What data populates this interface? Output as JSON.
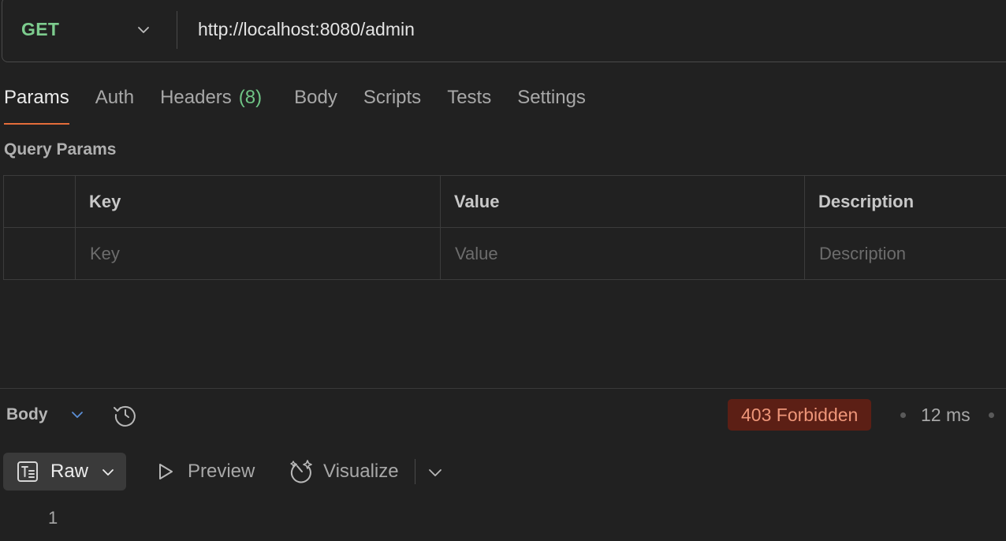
{
  "request": {
    "method": "GET",
    "url": "http://localhost:8080/admin"
  },
  "tabs": [
    {
      "label": "Params",
      "active": true
    },
    {
      "label": "Auth"
    },
    {
      "label": "Headers",
      "count": "(8)"
    },
    {
      "label": "Body"
    },
    {
      "label": "Scripts"
    },
    {
      "label": "Tests"
    },
    {
      "label": "Settings"
    }
  ],
  "query_params": {
    "title": "Query Params",
    "headers": {
      "key": "Key",
      "value": "Value",
      "description": "Description"
    },
    "placeholders": {
      "key": "Key",
      "value": "Value",
      "description": "Description"
    }
  },
  "response": {
    "section_label": "Body",
    "status": "403 Forbidden",
    "time": "12 ms",
    "views": {
      "raw": "Raw",
      "preview": "Preview",
      "visualize": "Visualize"
    },
    "line_number": "1"
  },
  "colors": {
    "method": "#7dcc8e",
    "tab_underline": "#e46d3a",
    "status_bg": "#5c1f15",
    "status_text": "#ee9679",
    "count": "#6fc485"
  }
}
